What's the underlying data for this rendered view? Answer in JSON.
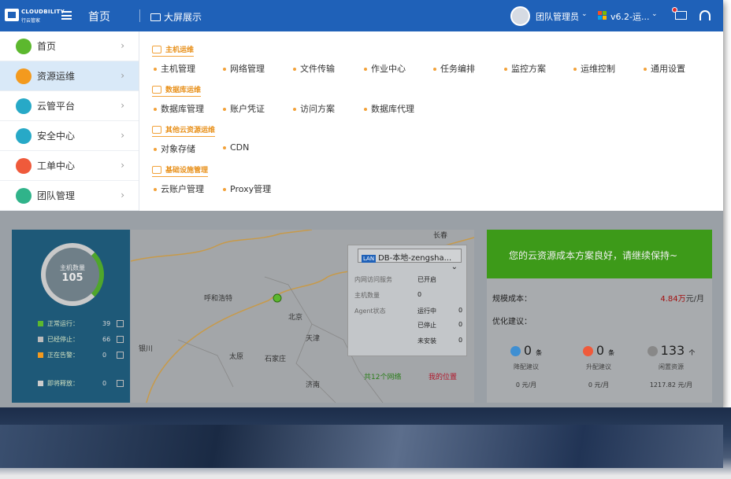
{
  "topbar": {
    "brand": "CLOUDBILITY",
    "brand_sub": "行云管家",
    "home": "首页",
    "big_screen": "大屏展示",
    "user": "团队管理员",
    "version": "v6.2-运..."
  },
  "sidebar": {
    "items": [
      {
        "label": "首页",
        "icon": "home-icon",
        "color": "#5cb82e"
      },
      {
        "label": "资源运维",
        "icon": "monitor-icon",
        "color": "#f39a1e",
        "active": true
      },
      {
        "label": "云管平台",
        "icon": "cloud-icon",
        "color": "#27a9c7"
      },
      {
        "label": "安全中心",
        "icon": "eye-icon",
        "color": "#27a9c7"
      },
      {
        "label": "工单中心",
        "icon": "clipboard-icon",
        "color": "#ef5a3b"
      },
      {
        "label": "团队管理",
        "icon": "team-icon",
        "color": "#30b38a"
      }
    ]
  },
  "menu": {
    "sections": [
      {
        "title": "主机运维",
        "items": [
          "主机管理",
          "网络管理",
          "文件传输",
          "作业中心",
          "任务编排",
          "监控方案",
          "运维控制",
          "通用设置"
        ]
      },
      {
        "title": "数据库运维",
        "items": [
          "数据库管理",
          "账户凭证",
          "访问方案",
          "数据库代理"
        ]
      },
      {
        "title": "其他云资源运维",
        "items": [
          "对象存储",
          "CDN"
        ]
      },
      {
        "title": "基础设施管理",
        "items": [
          "云账户管理",
          "Proxy管理"
        ]
      }
    ]
  },
  "host_panel": {
    "ring_label": "主机数量",
    "ring_value": "105",
    "stats": [
      {
        "label": "正常运行：",
        "value": "39",
        "color": "#5cb82e"
      },
      {
        "label": "已经停止：",
        "value": "66",
        "color": "#bbbbbb"
      },
      {
        "label": "正在告警：",
        "value": "0",
        "color": "#f39a1e"
      },
      {
        "label": "即将释放：",
        "value": "0",
        "color": "#cccccc"
      }
    ],
    "running_fraction": 0.37
  },
  "map": {
    "cities": [
      "长春",
      "呼和浩特",
      "北京",
      "天津",
      "银川",
      "太原",
      "石家庄",
      "济南"
    ],
    "popup": {
      "select": "DB-本地-zengsha...",
      "select_tag": "LAN",
      "rows": [
        {
          "label": "内网访问服务",
          "value": "已开启"
        },
        {
          "label": "主机数量",
          "value": "0"
        },
        {
          "label": "Agent状态",
          "value": "运行中",
          "count": "0"
        }
      ],
      "extra": [
        {
          "value": "已停止",
          "count": "0"
        },
        {
          "value": "未安装",
          "count": "0"
        }
      ],
      "networks": "共12个网络",
      "mylocation": "我的位置"
    }
  },
  "cost_panel": {
    "banner": "您的云资源成本方案良好，请继续保持~",
    "monthly_label": "规模成本：",
    "monthly_value": "4.84万",
    "monthly_unit": "元/月",
    "advice_label": "优化建议：",
    "cols": [
      {
        "value": "0",
        "unit": "条",
        "title": "降配建议",
        "money": "0 元/月",
        "color": "#3f8fd2"
      },
      {
        "value": "0",
        "unit": "条",
        "title": "升配建议",
        "money": "0 元/月",
        "color": "#ef5a3b"
      },
      {
        "value": "133",
        "unit": "个",
        "title": "闲置资源",
        "money": "1217.82 元/月",
        "color": "#888888"
      }
    ]
  }
}
